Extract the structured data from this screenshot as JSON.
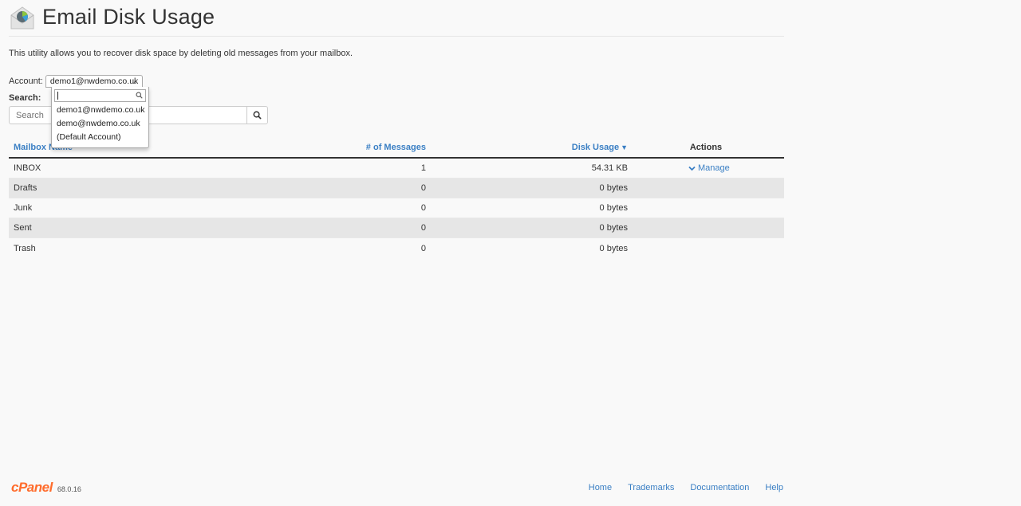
{
  "header": {
    "title": "Email Disk Usage",
    "icon": "email-disk-usage-icon"
  },
  "intro": "This utility allows you to recover disk space by deleting old messages from your mailbox.",
  "account": {
    "label": "Account:",
    "selected": "demo1@nwdemo.co.uk",
    "options": [
      "demo1@nwdemo.co.uk",
      "demo@nwdemo.co.uk",
      "(Default Account)"
    ],
    "filter_value": ""
  },
  "search": {
    "label": "Search:",
    "placeholder": "Search"
  },
  "table": {
    "columns": {
      "name": "Mailbox Name",
      "messages": "# of Messages",
      "disk": "Disk Usage",
      "actions": "Actions"
    },
    "sort": {
      "column": "disk",
      "direction": "desc"
    },
    "rows": [
      {
        "name": "INBOX",
        "messages": "1",
        "disk": "54.31 KB",
        "action": "Manage"
      },
      {
        "name": "Drafts",
        "messages": "0",
        "disk": "0 bytes",
        "action": ""
      },
      {
        "name": "Junk",
        "messages": "0",
        "disk": "0 bytes",
        "action": ""
      },
      {
        "name": "Sent",
        "messages": "0",
        "disk": "0 bytes",
        "action": ""
      },
      {
        "name": "Trash",
        "messages": "0",
        "disk": "0 bytes",
        "action": ""
      }
    ]
  },
  "footer": {
    "logo": "cPanel",
    "version": "68.0.16",
    "links": [
      "Home",
      "Trademarks",
      "Documentation",
      "Help"
    ]
  },
  "colors": {
    "link": "#3a7fc4",
    "brand": "#ff6c2c",
    "row_alt": "#e6e6e6"
  }
}
